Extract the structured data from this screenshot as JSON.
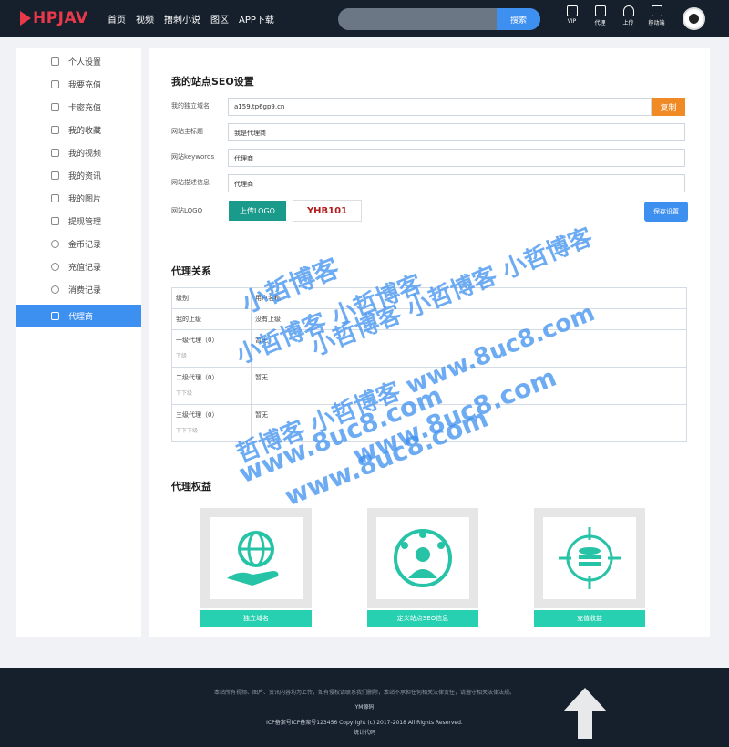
{
  "header": {
    "brand": "HPJAV",
    "nav": [
      "首页",
      "视频",
      "撸刺小说",
      "图区",
      "APP下载"
    ],
    "search_placeholder": "",
    "search_button": "搜索",
    "icons": [
      {
        "label": "VIP",
        "icon": "vip-icon"
      },
      {
        "label": "代理",
        "icon": "agent-icon"
      },
      {
        "label": "上传",
        "icon": "upload-icon"
      },
      {
        "label": "移动端",
        "icon": "mobile-icon"
      }
    ]
  },
  "sidebar": {
    "items": [
      {
        "label": "个人设置",
        "icon": "user-icon"
      },
      {
        "label": "我要充值",
        "icon": "medal-icon"
      },
      {
        "label": "卡密充值",
        "icon": "card-icon"
      },
      {
        "label": "我的收藏",
        "icon": "star-icon"
      },
      {
        "label": "我的视频",
        "icon": "video-icon"
      },
      {
        "label": "我的资讯",
        "icon": "book-icon"
      },
      {
        "label": "我的图片",
        "icon": "image-icon"
      },
      {
        "label": "提现管理",
        "icon": "withdraw-icon"
      },
      {
        "label": "金币记录",
        "icon": "coin-icon"
      },
      {
        "label": "充值记录",
        "icon": "history-icon"
      },
      {
        "label": "消费记录",
        "icon": "consume-icon"
      },
      {
        "label": "代理商",
        "icon": "agent-tree-icon"
      }
    ],
    "active_index": 11
  },
  "seo": {
    "title": "我的站点SEO设置",
    "fields": [
      {
        "label": "我的独立域名",
        "value": "a159.tp6gp9.cn"
      },
      {
        "label": "网站主标题",
        "value": "我是代理商"
      },
      {
        "label": "网站keywords",
        "value": "代理商"
      },
      {
        "label": "网站描述信息",
        "value": "代理商"
      }
    ],
    "copy_button": "复制",
    "logo_label": "网站LOGO",
    "upload_button": "上传LOGO",
    "logo_text": "YHB101",
    "save_button": "保存设置"
  },
  "relation": {
    "title": "代理关系",
    "headers": [
      "级别",
      "用户名称"
    ],
    "rows": [
      {
        "level": "我的上级",
        "sub": "",
        "name": "没有上级"
      },
      {
        "level": "一级代理（0）",
        "sub": "下级",
        "name": "暂无"
      },
      {
        "level": "二级代理（0）",
        "sub": "下下级",
        "name": "暂无"
      },
      {
        "level": "三级代理（0）",
        "sub": "下下下级",
        "name": "暂无"
      }
    ]
  },
  "benefits": {
    "title": "代理权益",
    "cards": [
      {
        "label": "独立域名",
        "icon": "globe-hand-icon"
      },
      {
        "label": "定义站点SEO信息",
        "icon": "network-user-icon"
      },
      {
        "label": "充值收益",
        "icon": "database-target-icon"
      }
    ]
  },
  "watermark": [
    "小哲博客",
    "小哲博客 小哲博客",
    "小哲博客 小哲博客 小哲博客",
    "哲博客 小哲博客 www.8uc8.com",
    "www.8uc8.com",
    "www.8uc8.com",
    "www.8uc8.com"
  ],
  "footer": {
    "line1": "本站所有视频、图片、资讯内容均为上传，如有侵权请联系我们删除，本站不承担任何相关法律责任，请遵守相关法律法规。",
    "line2": "YM源码",
    "line3": "ICP备案号ICP备案号123456   Copyright (c) 2017-2018 All Rights Reserved.",
    "line4": "统计代码"
  },
  "colors": {
    "accent": "#3d8ff0",
    "teal": "#26d0b0",
    "orange": "#f08a24",
    "topbar": "#16202c"
  }
}
